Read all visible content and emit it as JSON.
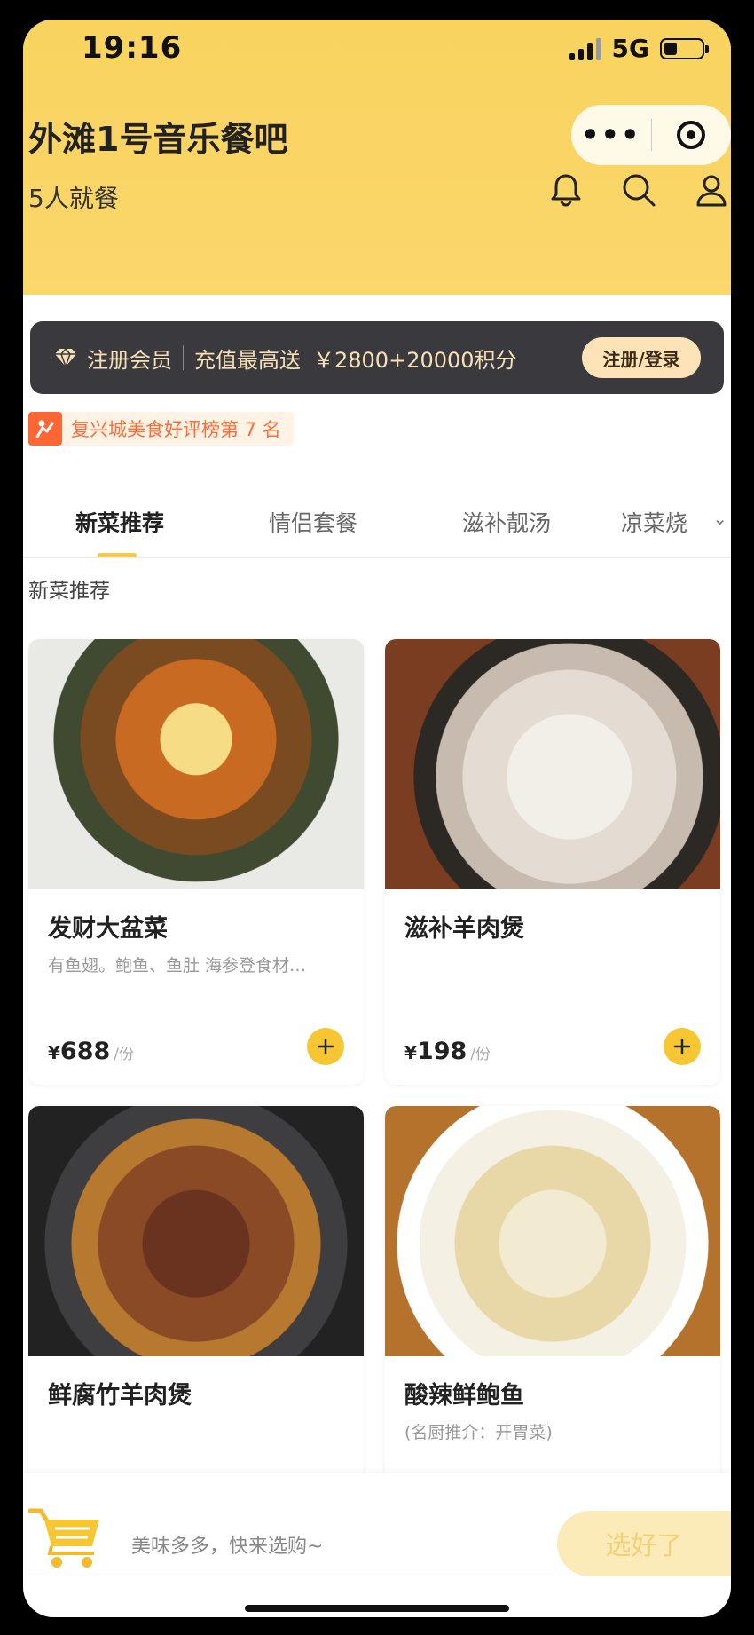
{
  "status_bar": {
    "time": "19:16",
    "network": "5G"
  },
  "header": {
    "store_name": "外滩1号音乐餐吧",
    "diners": "5人就餐",
    "capsule_more": "•••"
  },
  "member_banner": {
    "register_label": "注册会员",
    "recharge_label": "充值最高送",
    "bonus": "￥2800+20000积分",
    "button": "注册/登录"
  },
  "rank_badge": {
    "text": "复兴城美食好评榜第 7 名"
  },
  "tabs": [
    {
      "label": "新菜推荐",
      "active": true
    },
    {
      "label": "情侣套餐",
      "active": false
    },
    {
      "label": "滋补靓汤",
      "active": false
    },
    {
      "label": "凉菜烧",
      "active": false
    }
  ],
  "tab_more_arrow": "⌄",
  "section_title": "新菜推荐",
  "dishes": [
    {
      "name": "发财大盆菜",
      "desc": "有鱼翅。鲍鱼、鱼肚 海参登食材…",
      "currency": "¥",
      "price": "688",
      "unit": "/份"
    },
    {
      "name": "滋补羊肉煲",
      "desc": "",
      "currency": "¥",
      "price": "198",
      "unit": "/份"
    },
    {
      "name": "鲜腐竹羊肉煲",
      "desc": ""
    },
    {
      "name": "酸辣鲜鲍鱼",
      "desc": "(名厨推介：开胃菜)"
    }
  ],
  "bottom_bar": {
    "hint": "美味多多，快来选购~",
    "checkout": "选好了"
  },
  "colors": {
    "header_yellow": "#f9d35f",
    "accent": "#f7c633",
    "rank_orange": "#ff6633",
    "banner_dark": "#3a3a3e"
  }
}
